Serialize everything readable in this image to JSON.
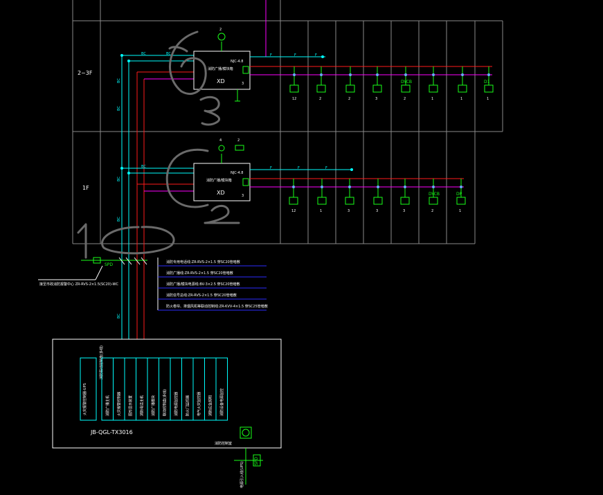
{
  "floors": {
    "upper": {
      "label": "2~3F",
      "box_label": "消防广播/模块箱",
      "box_code": "XD",
      "panel_code": "NJC-4.8",
      "sub_no": "3",
      "top_tag_no": "2",
      "devices": [
        {
          "code": "",
          "count": "12"
        },
        {
          "code": "",
          "count": "2"
        },
        {
          "code": "",
          "count": "2"
        },
        {
          "code": "",
          "count": "3"
        },
        {
          "code": "DYCB",
          "count": "2"
        },
        {
          "code": "",
          "count": "1"
        },
        {
          "code": "",
          "count": "1"
        },
        {
          "code": "D1",
          "count": "1"
        }
      ]
    },
    "lower": {
      "label": "1F",
      "box_label": "消防广播/模块箱",
      "box_code": "XD",
      "panel_code": "NJC-4.8",
      "sub_no": "3",
      "top_tag_no": "2",
      "top_tag_no_left": "4",
      "devices": [
        {
          "code": "",
          "count": "12"
        },
        {
          "code": "",
          "count": "1"
        },
        {
          "code": "",
          "count": "3"
        },
        {
          "code": "",
          "count": "3"
        },
        {
          "code": "",
          "count": "3"
        },
        {
          "code": "DYCB",
          "count": "2"
        },
        {
          "code": "DP",
          "count": "1"
        }
      ]
    }
  },
  "riser_tags": [
    "BC",
    "BC",
    "BC",
    "BC",
    "BC"
  ],
  "spd": {
    "label": "SPD",
    "note": "接至市政消防报警中心 ZR-RVS-2×1.5(SC20)-WC"
  },
  "annotations": {
    "upper_mark": "3",
    "lower_mark": "2",
    "bottom_mark": "1"
  },
  "legend_lines": [
    "消防专用电话线:ZR-RVS-2×1.5 穿SC20管暗敷",
    "消防广播线:ZR-RVS-2×1.5 穿SC20管暗敷",
    "消防广播/模块电源线:BV-3×2.5 穿SC20管暗敷",
    "消防信号总线:ZR-RVS-2×1.5 穿SC20管暗敷",
    "防火卷帘、排烟风机等联动控制线:ZR-KVV-4×1.5 穿SC25管暗敷"
  ],
  "console": {
    "model": "JB-QGL-TX3016",
    "left_col_a": "火灾报警控制器-UPS",
    "left_col_b": "消防联动控制盘(多线)",
    "columns": [
      "消防广播主机",
      "火灾报警控制器",
      "图形显示装置",
      "消防电话主机",
      "消防广播模块",
      "联动控制盘(多线)",
      "消防电源监控器",
      "防火门监控器",
      "电气火灾监控器",
      "消防应急照明",
      "消防设备电源监控"
    ],
    "bottom_label": "消防控制室",
    "cable_label": "电源引入线(UPS)",
    "spd_label": "SPD"
  },
  "colors": {
    "background": "#000000",
    "frame": "#ffffff",
    "riser": "#00ffff",
    "loop_power": "#ff1a1a",
    "loop_bus": "#ff00ff",
    "legend_line": "#2d2dff",
    "device": "#19ff19"
  }
}
